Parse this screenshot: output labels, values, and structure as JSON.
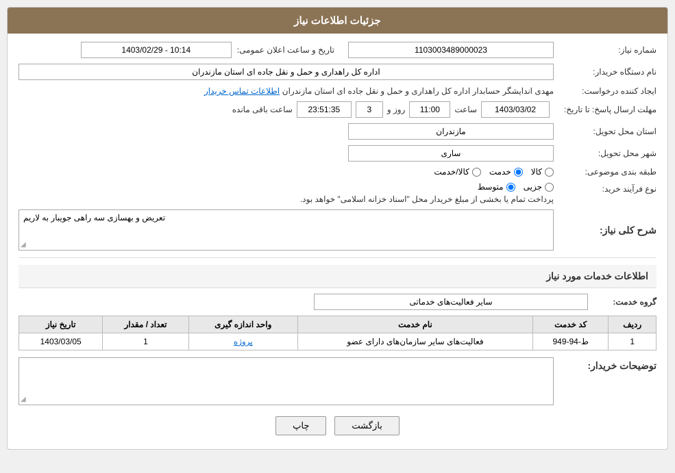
{
  "header": {
    "title": "جزئیات اطلاعات نیاز"
  },
  "fields": {
    "need_number_label": "شماره نیاز:",
    "need_number_value": "1103003489000023",
    "announcement_label": "تاریخ و ساعت اعلان عمومی:",
    "announcement_value": "1403/02/29 - 10:14",
    "buyer_org_label": "نام دستگاه خریدار:",
    "buyer_org_value": "اداره کل راهداری و حمل و نقل جاده ای استان مازندران",
    "creator_label": "ایجاد کننده درخواست:",
    "creator_name": "مهدی اندایشگر حسابدار اداره کل راهداری و حمل و نقل جاده ای استان مازندران",
    "creator_link": "اطلاعات تماس خریدار",
    "deadline_label": "مهلت ارسال پاسخ: تا تاریخ:",
    "deadline_date": "1403/03/02",
    "deadline_time_label": "ساعت",
    "deadline_time": "11:00",
    "deadline_days_label": "روز و",
    "deadline_days": "3",
    "deadline_remaining_label": "ساعت باقی مانده",
    "deadline_remaining": "23:51:35",
    "province_label": "استان محل تحویل:",
    "province_value": "مازندران",
    "city_label": "شهر محل تحویل:",
    "city_value": "ساری",
    "category_label": "طبقه بندی موضوعی:",
    "category_options": [
      "کالا",
      "خدمت",
      "کالا/خدمت"
    ],
    "category_selected": "خدمت",
    "process_label": "نوع فرآیند خرید:",
    "process_options": [
      "جزیی",
      "متوسط"
    ],
    "process_selected": "متوسط",
    "process_note": "پرداخت تمام یا بخشی از مبلغ خریدار محل \"اسناد خزانه اسلامی\" خواهد بود.",
    "need_desc_label": "شرح کلی نیاز:",
    "need_desc_value": "تعریض و بهسازی سه راهی جویبار به لاریم",
    "services_section_title": "اطلاعات خدمات مورد نیاز",
    "group_service_label": "گروه خدمت:",
    "group_service_value": "سایر فعالیت‌های خدماتی",
    "table": {
      "headers": [
        "ردیف",
        "کد خدمت",
        "نام خدمت",
        "واحد اندازه گیری",
        "تعداد / مقدار",
        "تاریخ نیاز"
      ],
      "rows": [
        {
          "row": "1",
          "code": "ط-94-949",
          "name": "فعالیت‌های سایر سازمان‌های دارای عضو",
          "unit": "پروژه",
          "qty": "1",
          "date": "1403/03/05"
        }
      ]
    },
    "buyer_notes_label": "توضیحات خریدار:",
    "buyer_notes_value": ""
  },
  "buttons": {
    "back_label": "بازگشت",
    "print_label": "چاپ"
  }
}
